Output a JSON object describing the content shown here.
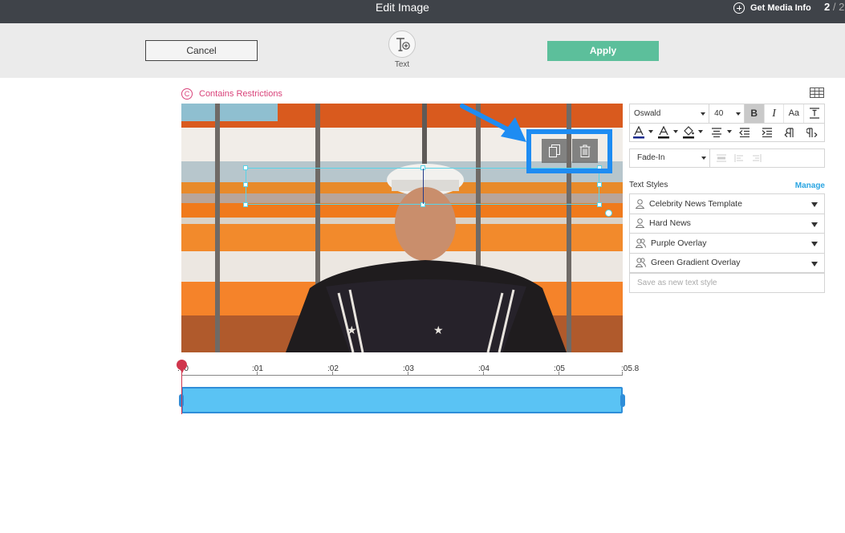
{
  "header": {
    "title": "Edit Image",
    "media_info_label": "Get Media Info",
    "page_current": "2",
    "page_total": "/ 2"
  },
  "toolbar": {
    "cancel_label": "Cancel",
    "apply_label": "Apply",
    "text_tool_label": "Text",
    "apply_color": "#5cbf9b"
  },
  "image": {
    "restriction_label": "Contains Restrictions",
    "restriction_color": "#d9437a"
  },
  "text_controls": {
    "font": "Oswald",
    "size": "40",
    "bold_glyph": "B",
    "italic_glyph": "I",
    "case_glyph": "Aa",
    "animation": "Fade-In",
    "highlight_color": "#1e8cf2"
  },
  "text_styles": {
    "heading": "Text Styles",
    "manage_label": "Manage",
    "items": [
      {
        "label": "Celebrity News Template"
      },
      {
        "label": "Hard News"
      },
      {
        "label": "Purple Overlay"
      },
      {
        "label": "Green Gradient Overlay"
      }
    ],
    "save_placeholder": "Save as new text style"
  },
  "timeline": {
    "labels": [
      ":00",
      ":01",
      ":02",
      ":03",
      ":04",
      ":05",
      ":05.8"
    ],
    "playhead_color": "#d0364d",
    "clip_color": "#5ac3f4"
  }
}
